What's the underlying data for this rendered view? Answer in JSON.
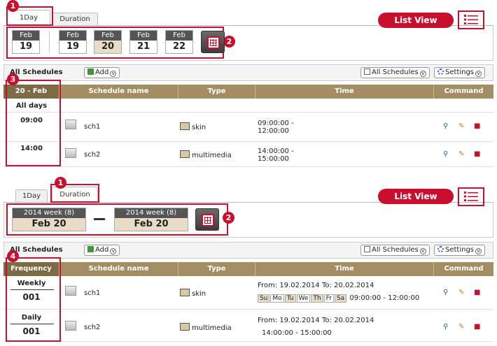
{
  "top": {
    "tabs": [
      "1Day",
      "Duration"
    ],
    "list_view": "List View",
    "badges": [
      "1",
      "2",
      "3"
    ],
    "dates": [
      {
        "mon": "Feb",
        "day": "19"
      },
      {
        "mon": "Feb",
        "day": "19"
      },
      {
        "mon": "Feb",
        "day": "20"
      },
      {
        "mon": "Feb",
        "day": "21"
      },
      {
        "mon": "Feb",
        "day": "22"
      }
    ],
    "toolbar": {
      "title": "All Schedules",
      "add": "Add",
      "filter": "All Schedules",
      "settings": "Settings"
    },
    "columns": {
      "left": "20 - Feb",
      "name": "Schedule name",
      "type": "Type",
      "time": "Time",
      "command": "Command"
    },
    "left_all": "All days",
    "rows": [
      {
        "hour": "09:00",
        "name": "sch1",
        "type": "skin",
        "time1": "09:00:00 -",
        "time2": "12:00:00"
      },
      {
        "hour": "14:00",
        "name": "sch2",
        "type": "multimedia",
        "time1": "14:00:00 -",
        "time2": "15:00:00"
      }
    ]
  },
  "bottom": {
    "tabs": [
      "1Day",
      "Duration"
    ],
    "list_view": "List View",
    "badges": [
      "1",
      "2",
      "4"
    ],
    "range_from": {
      "week": "2014 week (8)",
      "date": "Feb 20"
    },
    "range_to": {
      "week": "2014 week (8)",
      "date": "Feb 20"
    },
    "toolbar": {
      "title": "All Schedules",
      "add": "Add",
      "filter": "All Schedules",
      "settings": "Settings"
    },
    "columns": {
      "left": "Frequency",
      "name": "Schedule name",
      "type": "Type",
      "time": "Time",
      "command": "Command"
    },
    "rows": [
      {
        "freq": "Weekly",
        "num": "001",
        "name": "sch1",
        "type": "skin",
        "from": "From: 19.02.2014",
        "to": "To: 20.02.2014",
        "days": [
          "Su",
          "Mo",
          "Tu",
          "We",
          "Th",
          "Fr",
          "Sa"
        ],
        "hours": "09:00:00 - 12:00:00"
      },
      {
        "freq": "Daily",
        "num": "001",
        "name": "sch2",
        "type": "multimedia",
        "from": "From: 19.02.2014",
        "to": "To: 20.02.2014",
        "hours": "14:00:00 - 15:00:00"
      }
    ]
  },
  "colors": {
    "accent": "#c8102e",
    "header": "#a28e62",
    "selected": "#e8dcc6"
  }
}
